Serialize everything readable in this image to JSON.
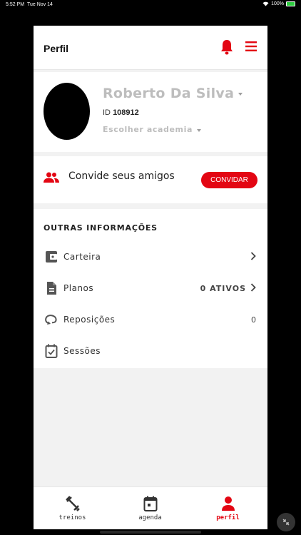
{
  "status_bar": {
    "time": "5:52 PM",
    "date": "Tue Nov 14",
    "battery": "100%"
  },
  "header": {
    "title": "Perfil",
    "accent_color": "#e30613"
  },
  "profile": {
    "name": "Roberto Da Silva",
    "id_label": "ID",
    "id_value": "108912",
    "gym_placeholder": "Escolher academia"
  },
  "invite": {
    "text": "Convide seus amigos",
    "button_label": "CONVIDAR"
  },
  "other_info": {
    "title": "OUTRAS INFORMAÇÕES",
    "items": [
      {
        "label": "Carteira",
        "icon": "wallet-icon",
        "value": "",
        "chevron": true
      },
      {
        "label": "Planos",
        "icon": "document-icon",
        "value": "0 ATIVOS",
        "chevron": true
      },
      {
        "label": "Reposições",
        "icon": "replay-icon",
        "value": "0",
        "chevron": false
      },
      {
        "label": "Sessões",
        "icon": "calendar-check-icon",
        "value": "",
        "chevron": false
      }
    ]
  },
  "bottom_nav": {
    "items": [
      {
        "label": "treinos",
        "icon": "dumbbell-icon",
        "active": false
      },
      {
        "label": "agenda",
        "icon": "calendar-icon",
        "active": false
      },
      {
        "label": "perfil",
        "icon": "person-icon",
        "active": true
      }
    ]
  }
}
